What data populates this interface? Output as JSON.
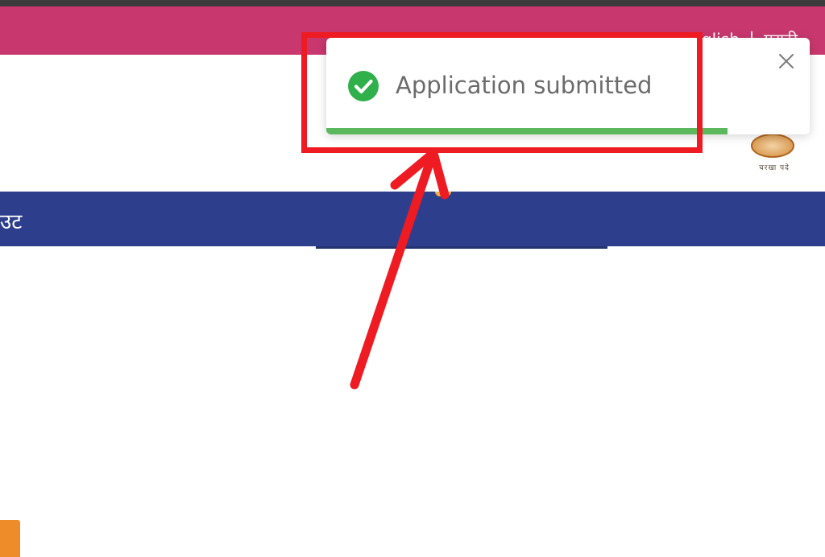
{
  "header": {
    "languages": [
      "English",
      "मराठी"
    ],
    "background_color": "#c8386e"
  },
  "logo": {
    "caption": "चरखा पदे"
  },
  "nav": {
    "visible_label": "उट",
    "background_color": "#2d3f8c"
  },
  "toast": {
    "icon": "check-circle-icon",
    "message": "Application submitted",
    "close_icon": "close-icon",
    "progress": 0.83,
    "progress_color": "#5cb85c",
    "success_color": "#2fb04a"
  },
  "annotation": {
    "color": "#ee1b22"
  },
  "corner_button": {
    "color": "#ef8c2a"
  }
}
